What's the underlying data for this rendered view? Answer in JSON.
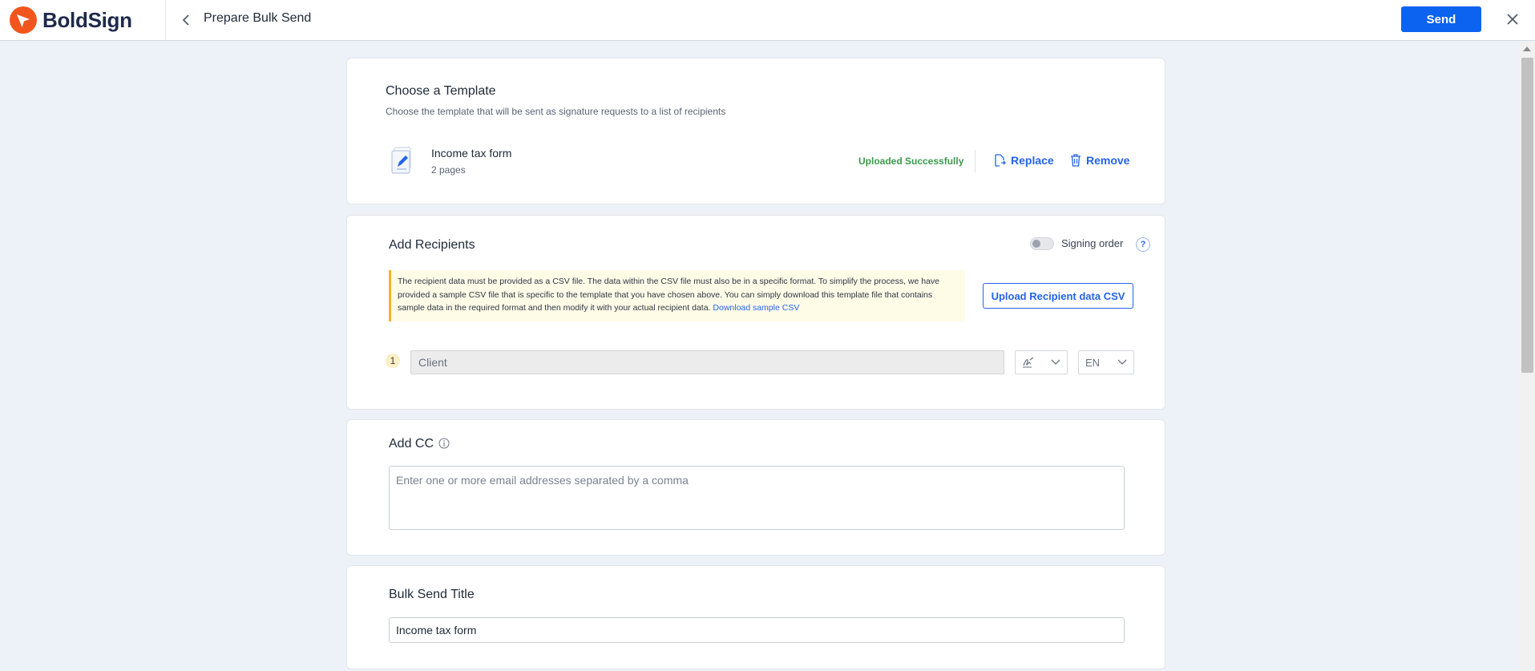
{
  "app": {
    "brand_name": "BoldSign",
    "page_title": "Prepare Bulk Send",
    "send_label": "Send",
    "brand_color": "#f2561d",
    "primary_color": "#0b63f0"
  },
  "template": {
    "title": "Choose a Template",
    "subtitle": "Choose the template that will be sent as signature requests to a list of recipients",
    "file_name": "Income tax form",
    "pages": "2 pages",
    "status": "Uploaded Successfully",
    "replace_label": "Replace",
    "remove_label": "Remove"
  },
  "recipients": {
    "title": "Add Recipients",
    "signing_order_label": "Signing order",
    "signing_order_enabled": false,
    "help_label": "?",
    "notice_text": "The recipient data must be provided as a CSV file. The data within the CSV file must also be in a specific format. To simplify the process, we have provided a sample CSV file that is specific to the template that you have chosen above. You can simply download this template file that contains sample data in the required format and then modify it with your actual recipient data.",
    "download_link": "Download sample CSV",
    "upload_label": "Upload Recipient data CSV",
    "rows": [
      {
        "number": "1",
        "role": "Client",
        "signer_type_icon": "signature-icon",
        "language": "EN"
      }
    ]
  },
  "cc": {
    "title": "Add CC",
    "placeholder": "Enter one or more email addresses separated by a comma"
  },
  "bulk_title": {
    "title": "Bulk Send Title",
    "value": "Income tax form"
  }
}
